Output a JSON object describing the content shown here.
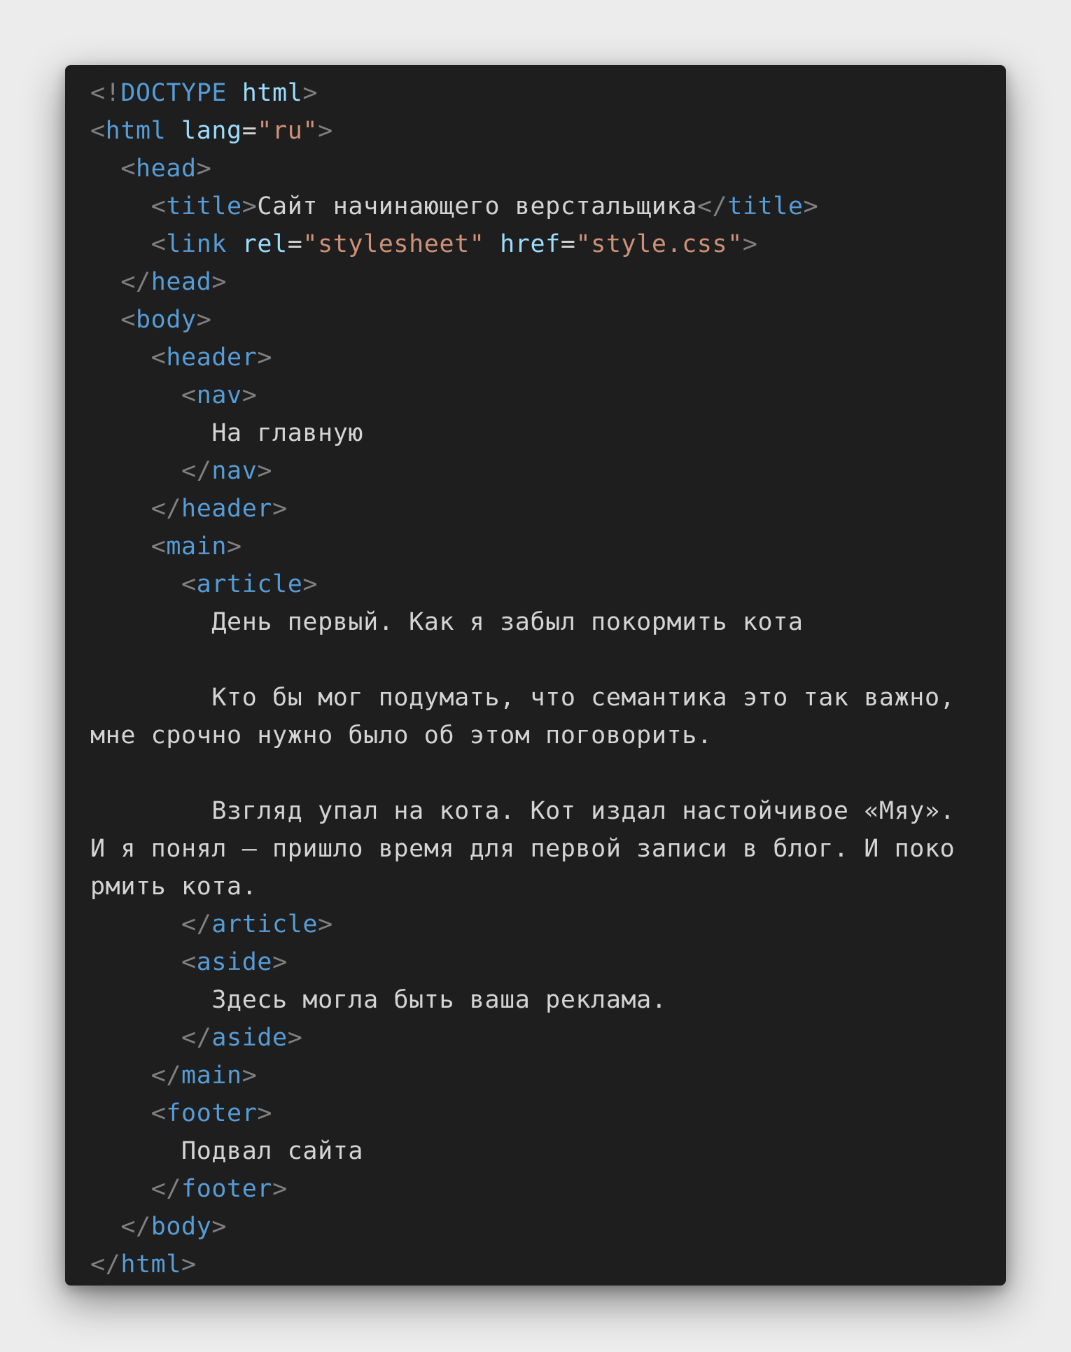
{
  "colors": {
    "background": "#ececec",
    "editor_background": "#1e1e1e",
    "punctuation": "#808080",
    "tag": "#569cd6",
    "attribute": "#9cdcfe",
    "string": "#ce9178",
    "text": "#d4d4d4"
  },
  "code": {
    "doctype_keyword": "DOCTYPE",
    "doctype_value": "html",
    "lang_value": "\"ru\"",
    "title_text": "Сайт начинающего верстальщика",
    "rel_value": "\"stylesheet\"",
    "href_value": "\"style.css\"",
    "nav_text": "На главную",
    "article_heading": "День первый. Как я забыл покормить кота",
    "article_p1_line1": "Кто бы мог подумать, что семантика это так важно,",
    "article_p1_line2": "мне срочно нужно было об этом поговорить.",
    "article_p2_line1": "Взгляд упал на кота. Кот издал настойчивое «Мяу».",
    "article_p2_line2": "И я понял — пришло время для первой записи в блог. И поко",
    "article_p2_line3": "рмить кота.",
    "aside_text": "Здесь могла быть ваша реклама.",
    "footer_text": "Подвал сайта"
  }
}
